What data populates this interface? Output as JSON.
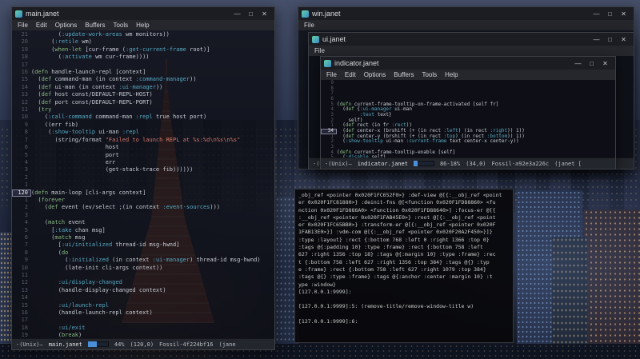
{
  "colors": {
    "titlebar": "#1b1d22",
    "accent_blue": "#4a90d9",
    "string_red": "#d0776a",
    "keyword_teal": "#56a8c2",
    "defn_green": "#87b87f"
  },
  "window_controls": {
    "minimize": "—",
    "maximize": "□",
    "close": "✕"
  },
  "left_window": {
    "title": "main.janet",
    "menus": [
      "File",
      "Edit",
      "Options",
      "Buffers",
      "Tools",
      "Help"
    ],
    "code": [
      {
        "n": "21",
        "t": "        (:update-work-areas wm monitors))"
      },
      {
        "n": "20",
        "t": "      (:retile wm)"
      },
      {
        "n": "19",
        "t": "      (when-let [cur-frame (:get-current-frame root)]"
      },
      {
        "n": "18",
        "t": "        (:activate wm cur-frame))))"
      },
      {
        "n": "17",
        "t": ""
      },
      {
        "n": "16",
        "t": "(defn handle-launch-repl [context]"
      },
      {
        "n": "15",
        "t": "  (def command-man (in context :command-manager))"
      },
      {
        "n": "14",
        "t": "  (def ui-man (in context :ui-manager))"
      },
      {
        "n": "13",
        "t": "  (def host const/DEFAULT-REPL-HOST)"
      },
      {
        "n": "12",
        "t": "  (def port const/DEFAULT-REPL-PORT)"
      },
      {
        "n": "11",
        "t": "  (try"
      },
      {
        "n": "10",
        "t": "    (:call-command command-man :repl true host port)"
      },
      {
        "n": "9",
        "t": "    ((err fib)"
      },
      {
        "n": "8",
        "t": "     (:show-tooltip ui-man :repl"
      },
      {
        "n": "7",
        "t": "       (string/format \"Failed to launch REPL at %s:%d\\n%s\\n%s\""
      },
      {
        "n": "6",
        "t": "                      host"
      },
      {
        "n": "5",
        "t": "                      port"
      },
      {
        "n": "4",
        "t": "                      err"
      },
      {
        "n": "3",
        "t": "                      (get-stack-trace fib))))))"
      },
      {
        "n": "2",
        "t": ""
      },
      {
        "n": "1",
        "t": ""
      },
      {
        "n": "120",
        "t": "(defn main-loop [cli-args context]",
        "cur": true
      },
      {
        "n": "1",
        "t": "  (forever"
      },
      {
        "n": "2",
        "t": "    (def event (ev/select ;(in context :event-sources)))"
      },
      {
        "n": "3",
        "t": ""
      },
      {
        "n": "4",
        "t": "    (match event"
      },
      {
        "n": "5",
        "t": "      [:take chan msg]"
      },
      {
        "n": "6",
        "t": "      (match msg"
      },
      {
        "n": "7",
        "t": "        [:ui/initialized thread-id msg-hwnd]"
      },
      {
        "n": "8",
        "t": "        (do"
      },
      {
        "n": "9",
        "t": "          (:initialized (in context :ui-manager) thread-id msg-hwnd)"
      },
      {
        "n": "10",
        "t": "          (late-init cli-args context))"
      },
      {
        "n": "11",
        "t": ""
      },
      {
        "n": "12",
        "t": "        :ui/display-changed"
      },
      {
        "n": "13",
        "t": "        (handle-display-changed context)"
      },
      {
        "n": "14",
        "t": ""
      },
      {
        "n": "15",
        "t": "        :ui/launch-repl"
      },
      {
        "n": "16",
        "t": "        (handle-launch-repl context)"
      },
      {
        "n": "17",
        "t": ""
      },
      {
        "n": "18",
        "t": "        :ui/exit"
      },
      {
        "n": "19",
        "t": "        (break)"
      }
    ],
    "status": {
      "prefix": "-(Unix)—",
      "file": "main.janet",
      "percent": "44%",
      "fill": 44,
      "pos": "(120,0)",
      "vcs": "Fossil-4f224bf16",
      "tail": "(jane"
    }
  },
  "win_window": {
    "title": "win.janet",
    "menus": [
      "File"
    ]
  },
  "ui_window": {
    "title": "ui.janet",
    "menus": [
      "File"
    ],
    "status_peek": "-(U"
  },
  "indicator_window": {
    "title": "indicator.janet",
    "menus": [
      "File",
      "Edit",
      "Options",
      "Buffers",
      "Tools",
      "Help"
    ],
    "code": [
      {
        "n": "9",
        "t": ""
      },
      {
        "n": "8",
        "t": ""
      },
      {
        "n": "7",
        "t": ""
      },
      {
        "n": "6",
        "t": ""
      },
      {
        "n": "5",
        "t": "(defn current-frame-tooltip-on-frame-activated [self fr]"
      },
      {
        "n": "4",
        "t": "  (def {:ui-manager ui-man"
      },
      {
        "n": "3",
        "t": "        :text text}"
      },
      {
        "n": "2",
        "t": "    self)"
      },
      {
        "n": "1",
        "t": "  (def rect (in fr :rect))"
      },
      {
        "n": "34",
        "t": "  (def center-x (brshift (+ (in rect :left) (in rect :right)) 1))",
        "cur": true
      },
      {
        "n": "1",
        "t": "  (def center-y (brshift (+ (in rect :top) (in rect :bottom)) 1))"
      },
      {
        "n": "2",
        "t": "  (:show-tooltip ui-man :current-frame text center-x center-y))"
      },
      {
        "n": "3",
        "t": ""
      },
      {
        "n": "4",
        "t": "(defn current-frame-tooltip-enable [self]"
      },
      {
        "n": "5",
        "t": "  (:disable self)"
      }
    ],
    "status": {
      "prefix": "-(Unix)—",
      "file": "indicator.janet",
      "percent": "86-18%",
      "fill": 18,
      "pos": "(34,0)",
      "vcs": "Fossil-a92e3a226c",
      "tail": "(janet ["
    }
  },
  "log_panel": {
    "lines": [
      "_obj_ref <pointer 0x020F1FC652F0>} :def-view @[{:__obj_ref <point",
      "er 0x020F1FC81880>} :deinit-fns @[<function 0x020F1FD88860> <fu",
      "nction 0x020F1FD886A0> <function 0x020F1FD88640>] :focus-er @[{",
      ":__obj_ref <pointer 0x020F1FAB45E0>} :root @[{:__obj_ref <point",
      "er 0x020F1FC65BB0>} :transform-er @[{:__obj_ref <pointer 0x020F",
      "1FAB13E0>}] :vdm-com @[{:__obj_ref <pointer 0x020F20A2F450>}]}",
      ":type :layout} :rect {:bottom 768 :left 0 :right 1366 :top 0}",
      ":tags @{:padding 10} :type :frame} :rect {:bottom 758 :left",
      "627 :right 1356 :top 18} :tags @{:margin 10} :type :frame} :rec",
      "t {:bottom 758 :left 627 :right 1356 :top 384} :tags @{} :typ",
      "e :frame} :rect {:bottom 758 :left 627 :right 1079 :top 384}",
      ":tags @{} :type :frame} :tags @{:anchor :center :margin 10} :t",
      "ype :window}",
      "[127.0.0.1:9999]:",
      "",
      "[127.0.0.1:9999]:5: (remove-title/remove-window-title w)",
      "",
      "[127.0.0.1:9999]:6:"
    ]
  }
}
